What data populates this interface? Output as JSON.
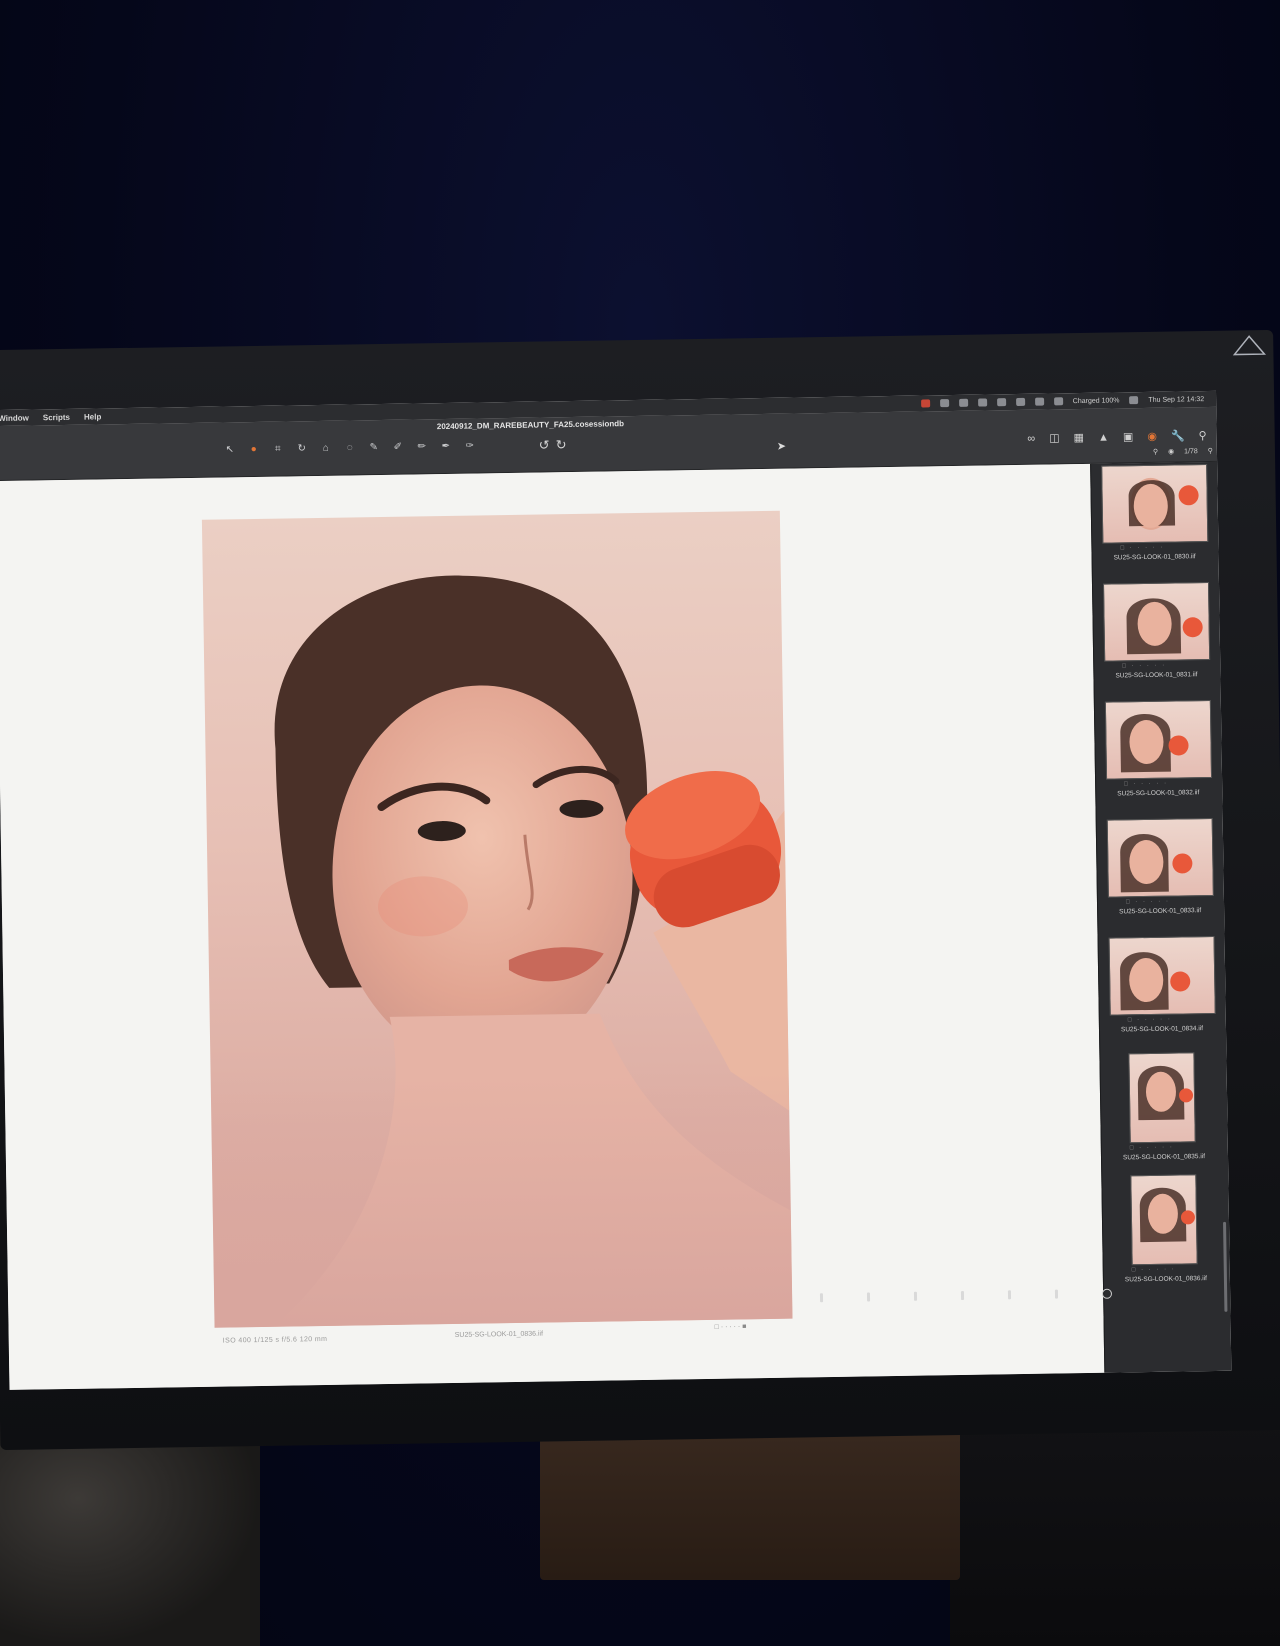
{
  "menubar": {
    "items": [
      "Window",
      "Scripts",
      "Help"
    ],
    "status_right": "Charged 100%",
    "clock": "Thu Sep 12  14:32"
  },
  "toolbar": {
    "document_title": "20240912_DM_RAREBEAUTY_FA25.cosessiondb",
    "image_count": "1/78"
  },
  "viewer": {
    "exif": "ISO 400   1/125 s   f/5.6   120 mm",
    "filename": "SU25-SG-LOOK-01_0836.iif",
    "rating": "□ · · · · ·  ■"
  },
  "filmstrip": {
    "thumbnails": [
      {
        "label": "SU25-SG-LOOK-01_0830.iif",
        "stars": "□ · · · · ·"
      },
      {
        "label": "SU25-SG-LOOK-01_0831.iif",
        "stars": "□ · · · · ·"
      },
      {
        "label": "SU25-SG-LOOK-01_0832.iif",
        "stars": "□ · · · · ·"
      },
      {
        "label": "SU25-SG-LOOK-01_0833.iif",
        "stars": "□ · · · · ·"
      },
      {
        "label": "SU25-SG-LOOK-01_0834.iif",
        "stars": "□ · · · · ·"
      },
      {
        "label": "SU25-SG-LOOK-01_0835.iif",
        "stars": "□ · · · · ·"
      },
      {
        "label": "SU25-SG-LOOK-01_0836.iif",
        "stars": "□ · · · · ·"
      }
    ]
  },
  "colors": {
    "accent": "#e17536",
    "compact_red": "#e8583a",
    "backdrop": "#e7c0b5"
  }
}
